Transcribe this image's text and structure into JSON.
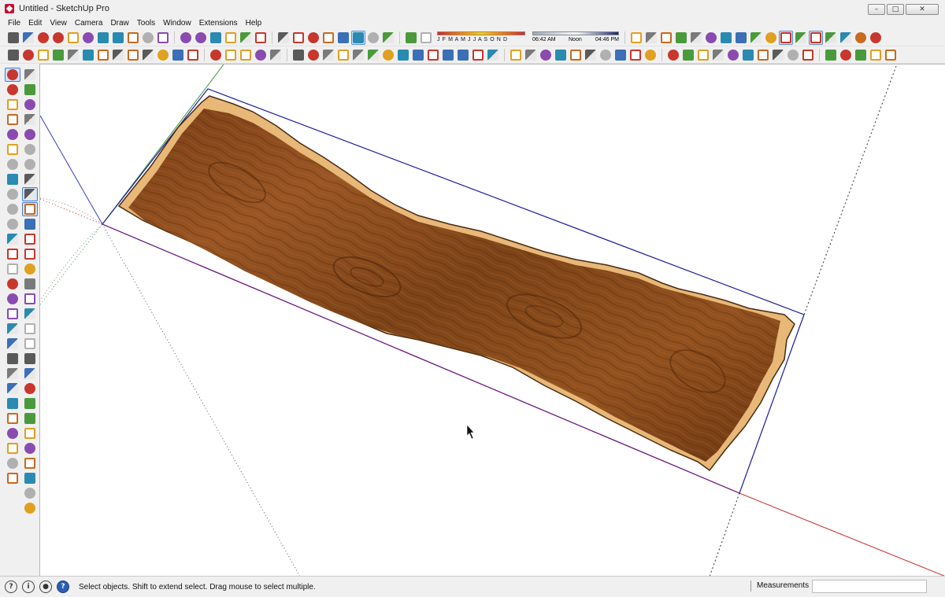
{
  "window": {
    "title": "Untitled - SketchUp Pro",
    "minimize_glyph": "–",
    "maximize_glyph": "□",
    "close_glyph": "✕"
  },
  "menu": [
    "File",
    "Edit",
    "View",
    "Camera",
    "Draw",
    "Tools",
    "Window",
    "Extensions",
    "Help"
  ],
  "shadow": {
    "months": "J F M A M J J A S O N D",
    "time_left": "06:42 AM",
    "time_mid": "Noon",
    "time_right": "04:46 PM"
  },
  "status": {
    "message": "Select objects. Shift to extend select. Drag mouse to select multiple.",
    "measurements_label": "Measurements",
    "measurements_value": ""
  },
  "toolbar_icons": {
    "row1_group1": [
      "new-icon",
      "open-icon",
      "save-icon",
      "cut-icon",
      "copy-icon",
      "paste-icon",
      "erase-icon",
      "undo-icon",
      "redo-icon",
      "print-icon",
      "model-info-icon"
    ],
    "row1_group2": [
      "components-icon",
      "materials-icon",
      "warehouse-icon",
      "house-icon",
      "house-outline-icon",
      "house-gable-icon"
    ],
    "row1_group3": [
      "section-plane-icon",
      "section-display-icon",
      "xray-icon",
      "wireframe-icon",
      "hidden-line-icon",
      "shaded-icon",
      "textured-icon",
      "monochrome-icon"
    ],
    "row1_group4": [
      "shadows-icon",
      "fog-icon"
    ],
    "row1_group5": [
      "iso-view-icon",
      "top-view-icon",
      "front-view-icon",
      "page-icon",
      "ext-a-icon",
      "ext-b-icon",
      "ext-c-icon",
      "red-cube-icon",
      "blue-cube-icon",
      "grey-cube-icon",
      "layers-icon",
      "scenes-icon",
      "film-icon",
      "bulb-icon",
      "diamond-icon",
      "palette-icon",
      "color-dots-icon"
    ],
    "row2_group1": [
      "arc-icon",
      "curve-icon",
      "spline-icon",
      "wave-icon",
      "helix-icon",
      "spiral-icon",
      "square-icon",
      "circle-icon",
      "arc2-icon",
      "arc3-icon",
      "freehand-icon",
      "arc4-icon",
      "arc5-icon"
    ],
    "row2_group2": [
      "zigzag-icon",
      "polygon-icon",
      "wrench-icon",
      "ellipse-icon",
      "lasso-icon"
    ],
    "row2_group3": [
      "dim-icon",
      "cross-icon",
      "measure-icon",
      "angle-icon",
      "slash-icon",
      "circle-slash-icon",
      "square-slash-icon",
      "grid-icon",
      "pencil2-icon",
      "extrude-icon",
      "line2-icon",
      "text-icon",
      "tape-icon",
      "question-icon"
    ],
    "row2_group4": [
      "sandbox1-icon",
      "sandbox2-icon",
      "sandbox3-icon",
      "sandbox4-icon",
      "sandbox5-icon",
      "sandbox6-icon",
      "sandbox7-icon",
      "sandbox8-icon",
      "sandbox9-icon",
      "sandbox10-icon"
    ],
    "row2_group5": [
      "solid1-icon",
      "solid2-icon",
      "solid3-icon",
      "solid4-icon",
      "solid5-icon",
      "solid6-icon",
      "solid7-icon",
      "solid8-icon",
      "solid9-icon",
      "solid10-icon"
    ],
    "row2_group6": [
      "dynamic-icon",
      "comp1-icon",
      "comp2-icon",
      "comp3-icon",
      "settings-icon"
    ]
  },
  "left_icons": {
    "col1": [
      "select-icon",
      "paint-icon",
      "pencil-icon",
      "rectangle-icon",
      "circle-icon",
      "arc-icon",
      "freehand-icon",
      "move-icon",
      "rotate-icon",
      "scale-icon",
      "tape-icon",
      "protractor-icon",
      "zoom-icon",
      "zoom-window-icon",
      "zoom-extents-icon",
      "position-camera-icon",
      "walk-icon",
      "look-icon",
      "section-icon",
      "axes-icon",
      "dimension-icon",
      "text-icon",
      "warehouse-icon",
      "extension-icon",
      "soften-icon",
      "sun-icon",
      "cube-red-icon",
      "slash-icon"
    ],
    "col2": [
      "component-icon",
      "eraser-icon",
      "pushpull-icon",
      "offset-icon",
      "follow-icon",
      "intersect-icon",
      "triangle-icon",
      "paint2-icon",
      "orbit-icon",
      "pan-icon",
      "front-icon",
      "right-icon",
      "back-icon",
      "align-icon",
      "stack-icon",
      "split-icon",
      "board-icon",
      "joinery-icon",
      "timber-icon",
      "beam-icon",
      "block-icon",
      "brace-icon",
      "truss-icon",
      "roof-icon",
      "wall-icon",
      "frame-icon",
      "stairs-icon",
      "door-icon",
      "window-icon",
      "settings2-icon"
    ]
  }
}
